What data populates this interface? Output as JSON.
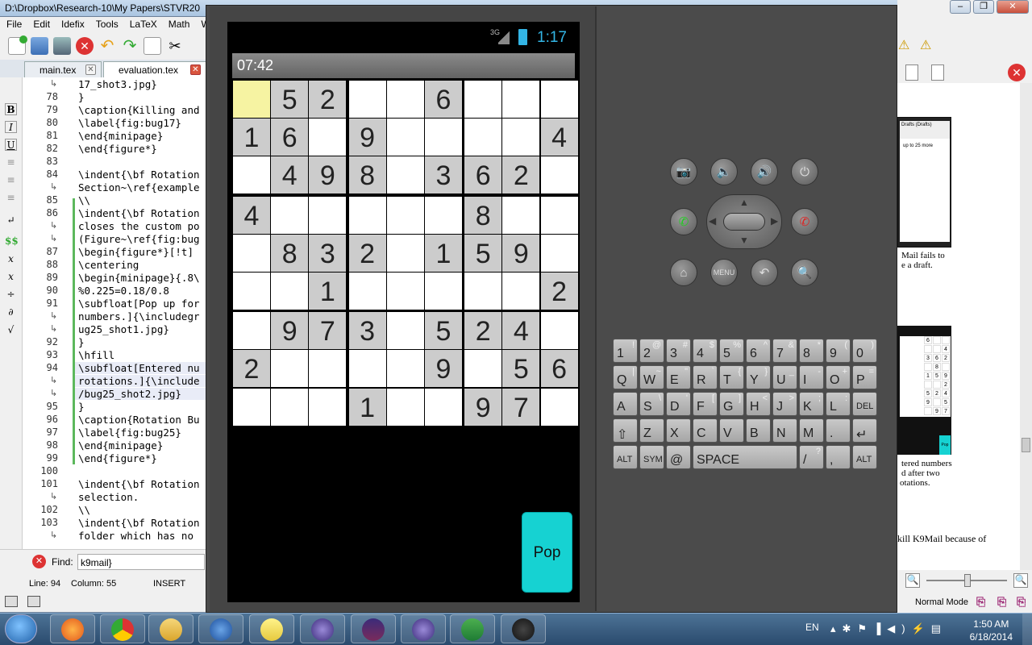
{
  "editor": {
    "title": "D:\\Dropbox\\Research-10\\My Papers\\STVR20",
    "menu": [
      "File",
      "Edit",
      "Idefix",
      "Tools",
      "LaTeX",
      "Math",
      "Wi"
    ],
    "tabs": [
      {
        "label": "main.tex"
      },
      {
        "label": "evaluation.tex"
      }
    ],
    "gutter_lines": [
      {
        "num": "",
        "wrap": true
      },
      {
        "num": "78"
      },
      {
        "num": "79"
      },
      {
        "num": "80"
      },
      {
        "num": "81"
      },
      {
        "num": "82"
      },
      {
        "num": "83"
      },
      {
        "num": "84"
      },
      {
        "num": "",
        "wrap": true
      },
      {
        "num": "85"
      },
      {
        "num": "86"
      },
      {
        "num": "",
        "wrap": true
      },
      {
        "num": "",
        "wrap": true
      },
      {
        "num": "87"
      },
      {
        "num": "88"
      },
      {
        "num": "89"
      },
      {
        "num": "90"
      },
      {
        "num": "91"
      },
      {
        "num": "",
        "wrap": true
      },
      {
        "num": "",
        "wrap": true
      },
      {
        "num": "92"
      },
      {
        "num": "93"
      },
      {
        "num": "94"
      },
      {
        "num": "",
        "wrap": true
      },
      {
        "num": "",
        "wrap": true
      },
      {
        "num": "95"
      },
      {
        "num": "96"
      },
      {
        "num": "97"
      },
      {
        "num": "98"
      },
      {
        "num": "99"
      },
      {
        "num": "100"
      },
      {
        "num": "101"
      },
      {
        "num": "",
        "wrap": true
      },
      {
        "num": "102"
      },
      {
        "num": "103"
      },
      {
        "num": "",
        "wrap": true
      }
    ],
    "code_lines": [
      "17_shot3.jpg}",
      "}",
      "\\caption{Killing and",
      "\\label{fig:bug17}",
      "\\end{minipage}",
      "\\end{figure*}",
      "",
      "\\indent{\\bf Rotation",
      "Section~\\ref{example",
      "\\\\",
      "\\indent{\\bf Rotation",
      "closes the custom po",
      "(Figure~\\ref{fig:bug",
      "\\begin{figure*}[!t]",
      "\\centering",
      "\\begin{minipage}{.8\\",
      "%0.225=0.18/0.8",
      "\\subfloat[Pop up for",
      "numbers.]{\\includegr",
      "ug25_shot1.jpg}",
      "}",
      "\\hfill",
      "\\subfloat[Entered nu",
      "rotations.]{\\include",
      "/bug25_shot2.jpg}",
      "}",
      "\\caption{Rotation Bu",
      "\\label{fig:bug25}",
      "\\end{minipage}",
      "\\end{figure*}",
      "",
      "\\indent{\\bf Rotation",
      "selection.",
      "\\\\",
      "\\indent{\\bf Rotation",
      "folder which has no "
    ],
    "find_label": "Find:",
    "find_value": "k9mail}",
    "status": {
      "line": "Line: 94",
      "column": "Column: 55",
      "mode": "INSERT"
    }
  },
  "emulator": {
    "status_time": "1:17",
    "network": "3G",
    "app_timer": "07:42",
    "sudoku": [
      [
        "",
        "5",
        "2",
        "",
        "",
        "6",
        "",
        "",
        ""
      ],
      [
        "1",
        "6",
        "",
        "9",
        "",
        "",
        "",
        "",
        "4"
      ],
      [
        "",
        "4",
        "9",
        "8",
        "",
        "3",
        "6",
        "2",
        ""
      ],
      [
        "4",
        "",
        "",
        "",
        "",
        "",
        "8",
        "",
        ""
      ],
      [
        "",
        "8",
        "3",
        "2",
        "",
        "1",
        "5",
        "9",
        ""
      ],
      [
        "",
        "",
        "1",
        "",
        "",
        "",
        "",
        "",
        "2"
      ],
      [
        "",
        "9",
        "7",
        "3",
        "",
        "5",
        "2",
        "4",
        ""
      ],
      [
        "2",
        "",
        "",
        "",
        "",
        "9",
        "",
        "5",
        "6"
      ],
      [
        "",
        "",
        "",
        "1",
        "",
        "",
        "9",
        "7",
        ""
      ]
    ],
    "shaded_cells": [
      [
        0,
        1
      ],
      [
        0,
        2
      ],
      [
        0,
        5
      ],
      [
        1,
        0
      ],
      [
        1,
        1
      ],
      [
        1,
        3
      ],
      [
        1,
        8
      ],
      [
        2,
        1
      ],
      [
        2,
        2
      ],
      [
        2,
        3
      ],
      [
        2,
        5
      ],
      [
        2,
        6
      ],
      [
        2,
        7
      ],
      [
        3,
        0
      ],
      [
        3,
        6
      ],
      [
        4,
        1
      ],
      [
        4,
        2
      ],
      [
        4,
        3
      ],
      [
        4,
        5
      ],
      [
        4,
        6
      ],
      [
        4,
        7
      ],
      [
        5,
        2
      ],
      [
        5,
        8
      ],
      [
        6,
        1
      ],
      [
        6,
        2
      ],
      [
        6,
        3
      ],
      [
        6,
        5
      ],
      [
        6,
        6
      ],
      [
        6,
        7
      ],
      [
        7,
        0
      ],
      [
        7,
        5
      ],
      [
        7,
        7
      ],
      [
        7,
        8
      ],
      [
        8,
        3
      ],
      [
        8,
        6
      ],
      [
        8,
        7
      ]
    ],
    "selected_cell": [
      0,
      0
    ],
    "pop_button": "Pop",
    "menu_button": "MENU",
    "keyboard": [
      [
        {
          "k": "1",
          "s": "!"
        },
        {
          "k": "2",
          "s": "@"
        },
        {
          "k": "3",
          "s": "#"
        },
        {
          "k": "4",
          "s": "$"
        },
        {
          "k": "5",
          "s": "%"
        },
        {
          "k": "6",
          "s": "^"
        },
        {
          "k": "7",
          "s": "&"
        },
        {
          "k": "8",
          "s": "*"
        },
        {
          "k": "9",
          "s": "("
        },
        {
          "k": "0",
          "s": ")"
        }
      ],
      [
        {
          "k": "Q",
          "s": "|"
        },
        {
          "k": "W",
          "s": "~"
        },
        {
          "k": "E",
          "s": "\""
        },
        {
          "k": "R",
          "s": "`"
        },
        {
          "k": "T",
          "s": "{"
        },
        {
          "k": "Y",
          "s": "}"
        },
        {
          "k": "U",
          "s": "_"
        },
        {
          "k": "I",
          "s": "-"
        },
        {
          "k": "O",
          "s": "+"
        },
        {
          "k": "P",
          "s": "="
        }
      ],
      [
        {
          "k": "A",
          "s": ""
        },
        {
          "k": "S",
          "s": "\\"
        },
        {
          "k": "D",
          "s": "'"
        },
        {
          "k": "F",
          "s": "["
        },
        {
          "k": "G",
          "s": "]"
        },
        {
          "k": "H",
          "s": "<"
        },
        {
          "k": "J",
          "s": ">"
        },
        {
          "k": "K",
          "s": ";"
        },
        {
          "k": "L",
          "s": ":"
        },
        {
          "k": "DEL",
          "s": ""
        }
      ],
      [
        {
          "k": "⇧",
          "s": ""
        },
        {
          "k": "Z",
          "s": ""
        },
        {
          "k": "X",
          "s": ""
        },
        {
          "k": "C",
          "s": ""
        },
        {
          "k": "V",
          "s": ""
        },
        {
          "k": "B",
          "s": ""
        },
        {
          "k": "N",
          "s": ""
        },
        {
          "k": "M",
          "s": ""
        },
        {
          "k": ".",
          "s": ""
        },
        {
          "k": "↵",
          "s": ""
        }
      ],
      [
        {
          "k": "ALT",
          "s": ""
        },
        {
          "k": "SYM",
          "s": ""
        },
        {
          "k": "@",
          "s": ""
        },
        {
          "k": "SPACE",
          "s": ""
        },
        {
          "k": "/",
          "s": "?"
        },
        {
          "k": ",",
          "s": ""
        },
        {
          "k": "ALT",
          "s": ""
        }
      ]
    ]
  },
  "doc": {
    "lines": [
      {
        "t": "Mail  fails  to"
      },
      {
        "t": "e a draft."
      },
      {
        "t": "tered  numbers"
      },
      {
        "t": "d  after  two"
      },
      {
        "t": "otations."
      },
      {
        "t": "kill K9Mail because of"
      }
    ],
    "mini_label": "Drafts (Drafts)",
    "mini_sub": "up to 25 more",
    "mini_pop": "Pop",
    "mini_sudoku": [
      [
        "6",
        "",
        ""
      ],
      [
        "",
        "",
        "4"
      ],
      [
        "3",
        "6",
        "2"
      ],
      [
        "",
        "8",
        ""
      ],
      [
        "1",
        "5",
        "9"
      ],
      [
        "",
        "",
        "2"
      ],
      [
        "5",
        "2",
        "4"
      ],
      [
        "9",
        "",
        "5"
      ],
      [
        "",
        "9",
        "7"
      ]
    ],
    "normal_mode": "Normal Mode"
  },
  "taskbar": {
    "lang": "EN",
    "time": "1:50 AM",
    "date": "6/18/2014",
    "apps": [
      "firefox",
      "chrome",
      "explorer",
      "thunderbird",
      "notes",
      "eclipse",
      "texmaker",
      "eclipse2",
      "excel",
      "android"
    ]
  }
}
